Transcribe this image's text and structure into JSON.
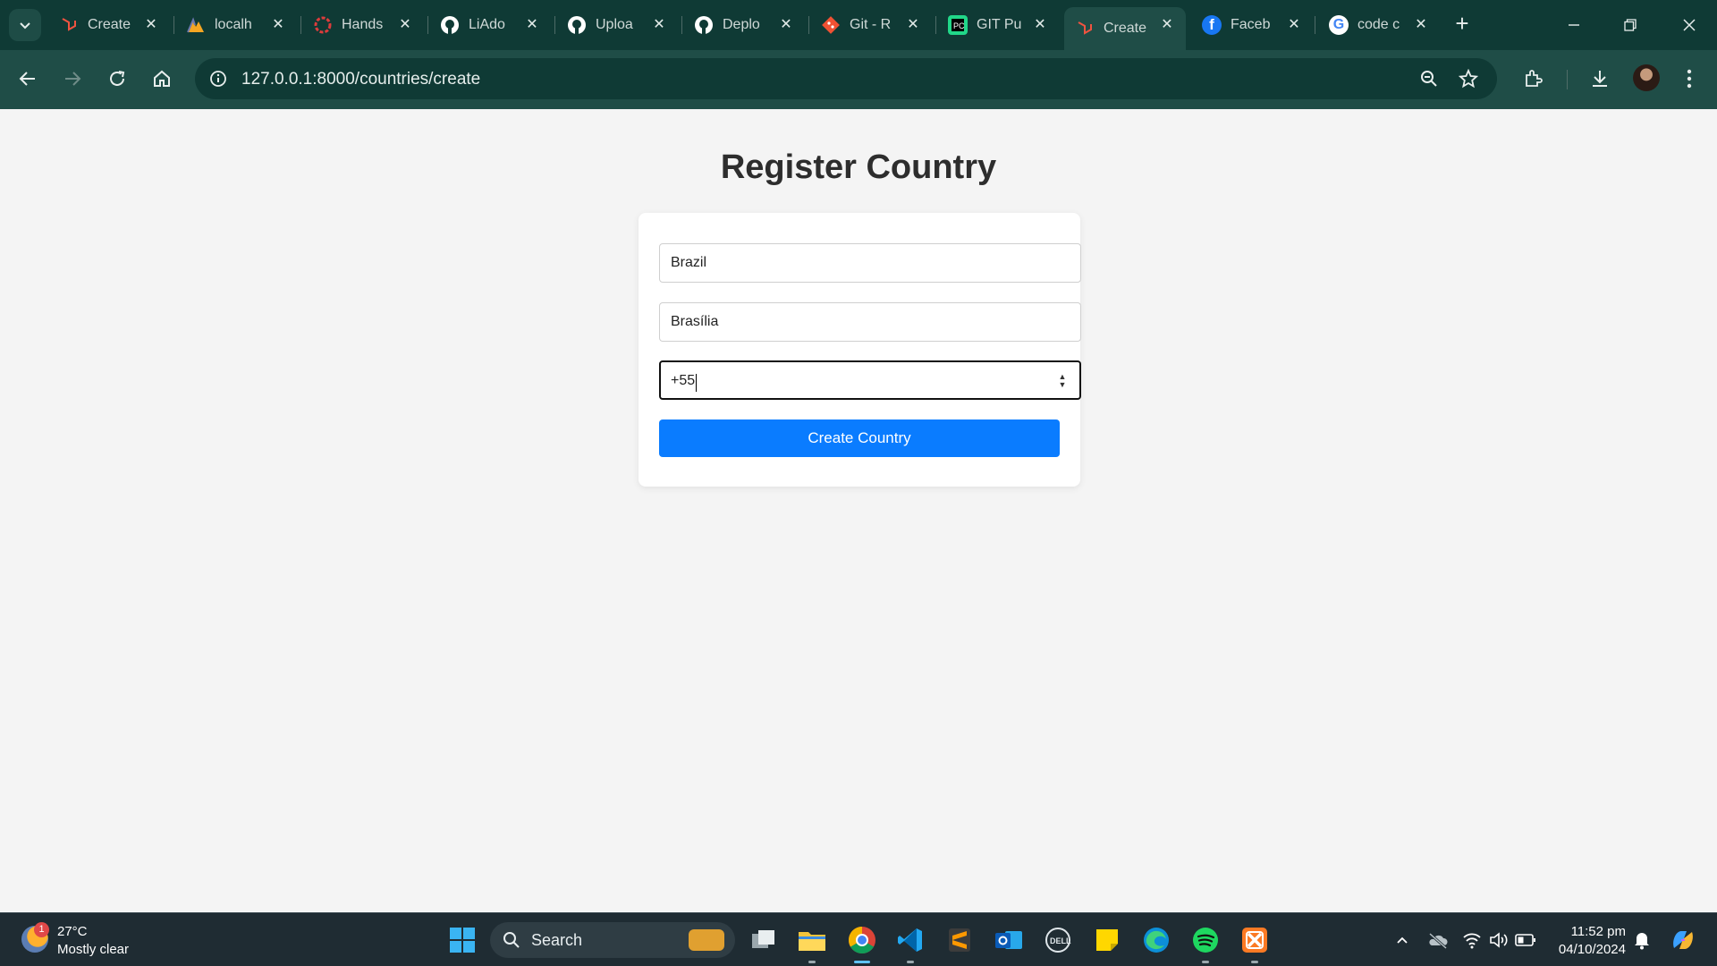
{
  "browser": {
    "tabs": [
      {
        "title": "Create",
        "icon": "laravel-icon",
        "color": "#f05340"
      },
      {
        "title": "localh",
        "icon": "phpmyadmin-icon",
        "color": "#f5a623"
      },
      {
        "title": "Hands",
        "icon": "angular-ring-icon",
        "color": "#dd3c3c"
      },
      {
        "title": "LiAdo",
        "icon": "github-icon",
        "color": "#ffffff"
      },
      {
        "title": "Uploa",
        "icon": "github-icon",
        "color": "#ffffff"
      },
      {
        "title": "Deplo",
        "icon": "github-icon",
        "color": "#ffffff"
      },
      {
        "title": "Git - R",
        "icon": "git-icon",
        "color": "#f05133"
      },
      {
        "title": "GIT Pu",
        "icon": "pycharm-icon",
        "color": "#21d789"
      },
      {
        "title": "Create",
        "icon": "laravel-icon",
        "color": "#f05340",
        "active": true
      },
      {
        "title": "Faceb",
        "icon": "facebook-icon",
        "color": "#1877f2"
      },
      {
        "title": "code c",
        "icon": "google-icon",
        "color": "#ffffff"
      }
    ],
    "url": "127.0.0.1:8000/countries/create"
  },
  "page": {
    "title": "Register Country",
    "form": {
      "country_name": "Brazil",
      "capital": "Brasília",
      "phone_code": "+55",
      "submit_label": "Create Country"
    }
  },
  "taskbar": {
    "weather": {
      "temp": "27°C",
      "desc": "Mostly clear",
      "badge": "1"
    },
    "search_label": "Search",
    "clock_time": "11:52 pm",
    "clock_date": "04/10/2024"
  },
  "colors": {
    "accent": "#0a7cff",
    "chrome_dark": "#0f3a35",
    "chrome_toolbar": "#1f4d47",
    "page_bg": "#f4f4f4"
  }
}
